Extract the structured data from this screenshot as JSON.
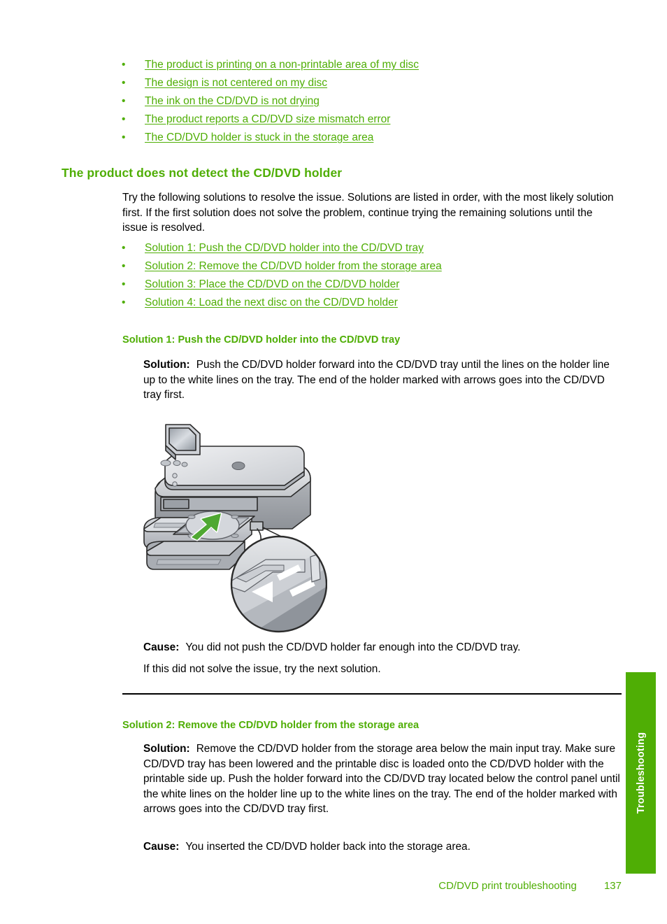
{
  "colors": {
    "link_green": "#4fae05",
    "heading_green": "#4fae05",
    "tab_green": "#4fae05",
    "body_black": "#000000",
    "arrow_green": "#4fa832"
  },
  "toc": {
    "bullet": "•",
    "items": [
      {
        "label": "The product is printing on a non-printable area of my disc"
      },
      {
        "label": "The design is not centered on my disc"
      },
      {
        "label": "The ink on the CD/DVD is not drying"
      },
      {
        "label": "The product reports a CD/DVD size mismatch error"
      },
      {
        "label": "The CD/DVD holder is stuck in the storage area"
      }
    ]
  },
  "main": {
    "heading": "The product does not detect the CD/DVD holder",
    "intro": "Try the following solutions to resolve the issue. Solutions are listed in order, with the most likely solution first. If the first solution does not solve the problem, continue trying the remaining solutions until the issue is resolved.",
    "solution_links": {
      "bullet": "•",
      "items": [
        {
          "label": "Solution 1: Push the CD/DVD holder into the CD/DVD tray"
        },
        {
          "label": "Solution 2: Remove the CD/DVD holder from the storage area"
        },
        {
          "label": "Solution 3: Place the CD/DVD on the CD/DVD holder"
        },
        {
          "label": "Solution 4: Load the next disc on the CD/DVD holder"
        }
      ]
    }
  },
  "solution1": {
    "heading": "Solution 1: Push the CD/DVD holder into the CD/DVD tray",
    "solution_label": "Solution:",
    "solution_text": "Push the CD/DVD holder forward into the CD/DVD tray until the lines on the holder line up to the white lines on the tray. The end of the holder marked with arrows goes into the CD/DVD tray first.",
    "cause_label": "Cause:",
    "cause_text": "You did not push the CD/DVD holder far enough into the CD/DVD tray.",
    "next_text": "If this did not solve the issue, try the next solution.",
    "figure": {
      "name": "all-in-one-printer-with-cd-dvd-holder-inserted",
      "callout": "magnified-detail-of-tray-alignment-arrow-and-white-lines"
    }
  },
  "solution2": {
    "heading": "Solution 2: Remove the CD/DVD holder from the storage area",
    "solution_label": "Solution:",
    "solution_text": "Remove the CD/DVD holder from the storage area below the main input tray. Make sure CD/DVD tray has been lowered and the printable disc is loaded onto the CD/DVD holder with the printable side up. Push the holder forward into the CD/DVD tray located below the control panel until the white lines on the holder line up to the white lines on the tray. The end of the holder marked with arrows goes into the CD/DVD tray first.",
    "cause_label": "Cause:",
    "cause_text": "You inserted the CD/DVD holder back into the storage area."
  },
  "side_tab": {
    "label": "Troubleshooting"
  },
  "footer": {
    "title": "CD/DVD print troubleshooting",
    "page_number": "137"
  }
}
